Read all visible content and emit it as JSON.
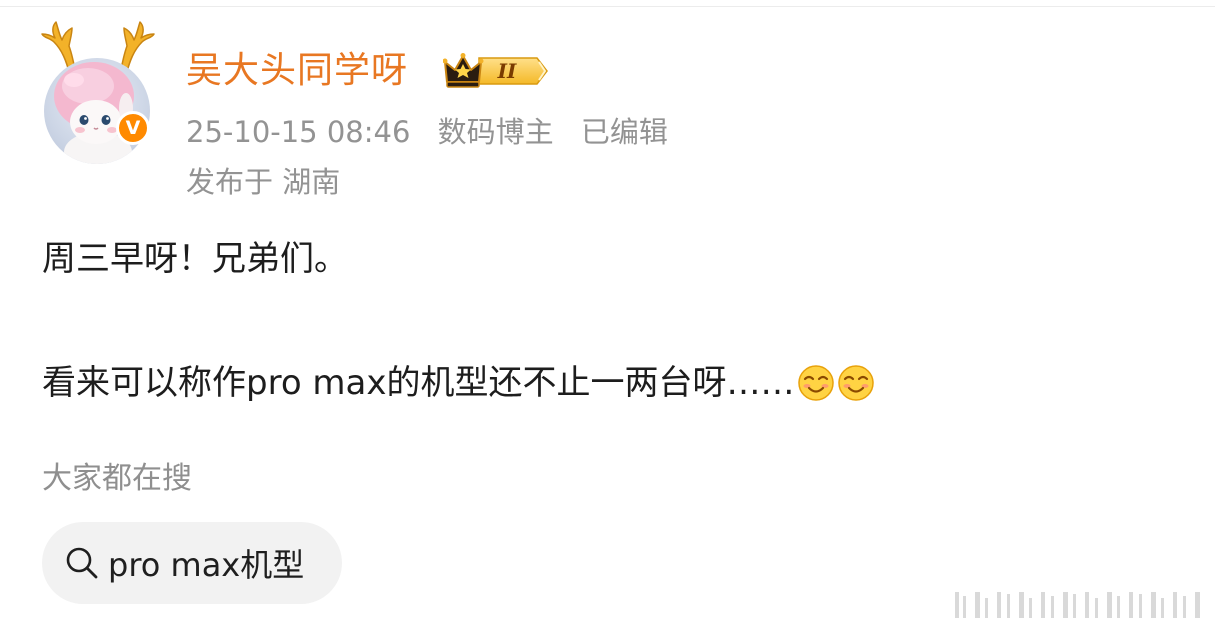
{
  "user": {
    "name": "吴大头同学呀",
    "verified_badge": "V",
    "rank_badge": "II"
  },
  "meta": {
    "time": "25-10-15 08:46",
    "category": "数码博主",
    "edited": "已编辑",
    "location": "发布于 湖南"
  },
  "post": {
    "line1": "周三早呀！兄弟们。",
    "line2": "看来可以称作pro max的机型还不止一两台呀……"
  },
  "search": {
    "heading": "大家都在搜",
    "chip_label": "pro max机型"
  },
  "icons": {
    "verified": "verified-v-icon",
    "rank": "crown-rank-icon",
    "emoji": "smile-emoji-icon",
    "search": "search-icon"
  },
  "colors": {
    "username": "#e87722",
    "verified": "#ff8a00",
    "meta_text": "#939393",
    "body_text": "#1d1d1d",
    "chip_bg": "#f2f2f2"
  }
}
